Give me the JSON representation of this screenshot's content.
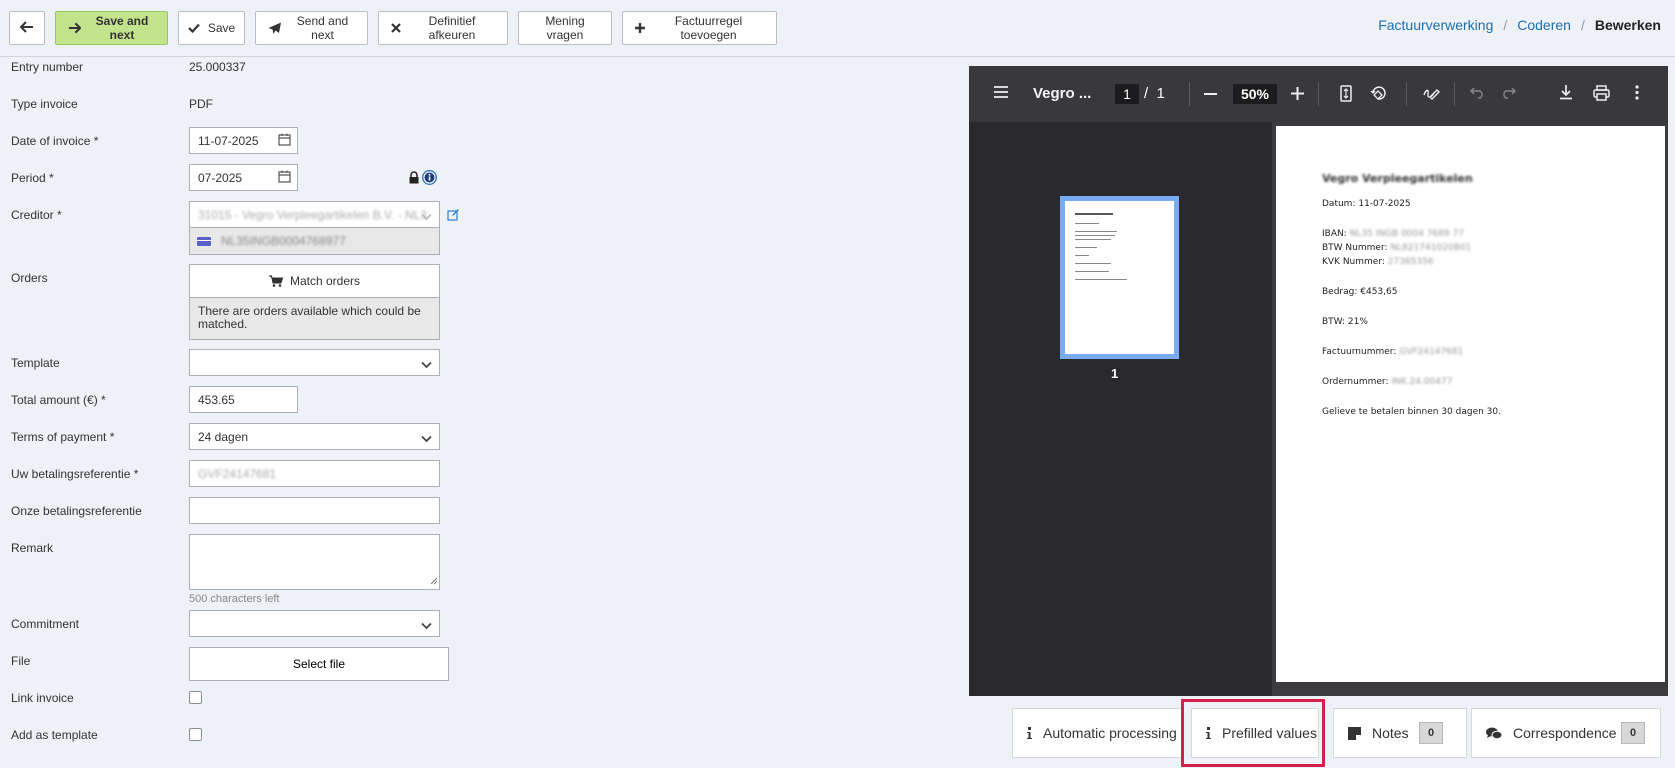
{
  "toolbar": {
    "back_label": "",
    "save_next_label": "Save and next",
    "save_label": "Save",
    "send_next_label": "Send and next",
    "reject_label": "Definitief afkeuren",
    "opinion_label": "Mening vragen",
    "add_line_label": "Factuurregel toevoegen"
  },
  "breadcrumb": {
    "items": [
      "Factuurverwerking",
      "Coderen"
    ],
    "current": "Bewerken",
    "separator": "/"
  },
  "form": {
    "entry_number": {
      "label": "Entry number",
      "value": "25.000337"
    },
    "type_invoice": {
      "label": "Type invoice",
      "value": "PDF"
    },
    "date_of_invoice": {
      "label": "Date of invoice *",
      "value": "11-07-2025"
    },
    "period": {
      "label": "Period *",
      "value": "07-2025"
    },
    "creditor": {
      "label": "Creditor *",
      "value": "31015 - Vegro Verpleegartikelen B.V. - NL35I",
      "iban": "NL35INGB0004768977"
    },
    "orders": {
      "label": "Orders",
      "button": "Match orders",
      "note": "There are orders available which could be matched."
    },
    "template": {
      "label": "Template",
      "value": ""
    },
    "total_amount": {
      "label": "Total amount (€) *",
      "value": "453.65"
    },
    "terms_of_payment": {
      "label": "Terms of payment *",
      "value": "24 dagen"
    },
    "uw_referentie": {
      "label": "Uw betalingsreferentie *",
      "value": "GVF24147681"
    },
    "onze_referentie": {
      "label": "Onze betalingsreferentie",
      "value": ""
    },
    "remark": {
      "label": "Remark",
      "chars_left": "500 characters left"
    },
    "commitment": {
      "label": "Commitment",
      "value": ""
    },
    "file": {
      "label": "File",
      "button": "Select file"
    },
    "link_invoice": {
      "label": "Link invoice"
    },
    "add_template": {
      "label": "Add as template"
    }
  },
  "viewer": {
    "title": "Vegro ...",
    "page_current": "1",
    "page_total": "1",
    "zoom": "50%",
    "thumb_number": "1",
    "document": {
      "heading": "Vegro Verpleegartikelen",
      "datum": "Datum: 11-07-2025",
      "iban_label": "IBAN:",
      "iban_value": " NL35 INGB 0004 7689 77",
      "btw_label": "BTW Nummer:",
      "btw_value": " NL821741020B01",
      "kvk_label": "KVK Nummer:",
      "kvk_value": " 27365356",
      "bedrag": "Bedrag: €453,65",
      "btw_pct": "BTW: 21%",
      "factuur_label": "Factuurnummer:",
      "factuur_value": " GVF24147681",
      "order_label": "Ordernummer:",
      "order_value": " INK.24.00477",
      "footer": "Gelieve te betalen binnen 30 dagen 30."
    }
  },
  "tabs": {
    "automatic": "Automatic processing",
    "prefilled": "Prefilled values",
    "notes": "Notes",
    "notes_count": "0",
    "correspondence": "Correspondence",
    "correspondence_count": "0"
  },
  "colors": {
    "primary_button": "#c3e28c",
    "link": "#1f6fb0",
    "highlight": "#d6204b"
  }
}
